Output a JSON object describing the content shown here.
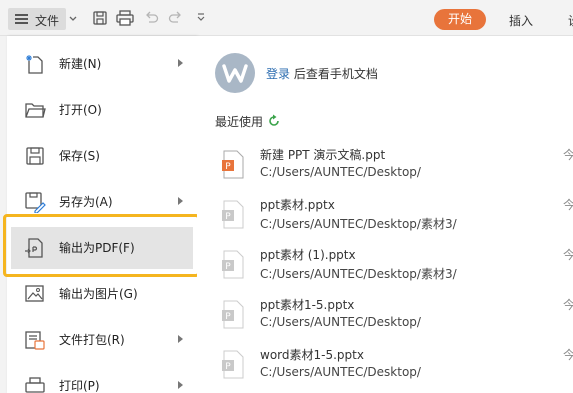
{
  "toolbar": {
    "file_label": "文件",
    "start_tab": "开始",
    "insert_tab": "插入",
    "more_tab": "设"
  },
  "menu": {
    "items": [
      {
        "label": "新建(N)",
        "icon": "new-doc-icon",
        "has_submenu": true
      },
      {
        "label": "打开(O)",
        "icon": "folder-open-icon",
        "has_submenu": false
      },
      {
        "label": "保存(S)",
        "icon": "save-icon",
        "has_submenu": false
      },
      {
        "label": "另存为(A)",
        "icon": "save-as-icon",
        "has_submenu": true
      },
      {
        "label": "输出为PDF(F)",
        "icon": "export-pdf-icon",
        "has_submenu": false,
        "selected": true
      },
      {
        "label": "输出为图片(G)",
        "icon": "export-image-icon",
        "has_submenu": false
      },
      {
        "label": "文件打包(R)",
        "icon": "package-icon",
        "has_submenu": true
      },
      {
        "label": "打印(P)",
        "icon": "print-icon",
        "has_submenu": true
      }
    ]
  },
  "account": {
    "login_link": "登录",
    "login_text": " 后查看手机文档"
  },
  "recent": {
    "title": "最近使用",
    "files": [
      {
        "name": "新建 PPT 演示文稿.ppt",
        "path": "C:/Users/AUNTEC/Desktop/",
        "side": "今"
      },
      {
        "name": "ppt素材.pptx",
        "path": "C:/Users/AUNTEC/Desktop/素材3/",
        "side": "今"
      },
      {
        "name": "ppt素材 (1).pptx",
        "path": "C:/Users/AUNTEC/Desktop/素材3/",
        "side": "今"
      },
      {
        "name": "ppt素材1-5.pptx",
        "path": "C:/Users/AUNTEC/Desktop/",
        "side": "今"
      },
      {
        "name": "word素材1-5.pptx",
        "path": "C:/Users/AUNTEC/Desktop/",
        "side": "今"
      }
    ]
  },
  "colors": {
    "accent": "#e8743b",
    "highlight": "#f5b51f",
    "link": "#2b6cb0",
    "refresh": "#3aa34a"
  }
}
